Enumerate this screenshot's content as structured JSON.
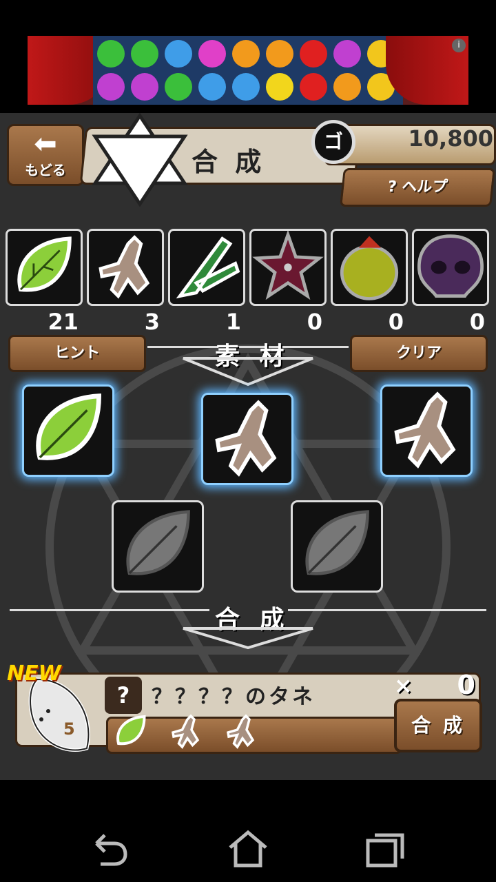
{
  "ad": {
    "info_icon": "info-icon",
    "candy_colors": [
      "#3bbf3b",
      "#3bbf3b",
      "#3f9de8",
      "#e040c8",
      "#f29a1c",
      "#f29a1c",
      "#e02020",
      "#c040d0",
      "#f2c61c",
      "#c040d0",
      "#c040d0",
      "#3bbf3b",
      "#3f9de8",
      "#3f9de8",
      "#f2d61c",
      "#e02020",
      "#f29a1c",
      "#f2c61c"
    ]
  },
  "header": {
    "back_label": "もどる",
    "back_icon": "arrow-left-icon",
    "title": "合 成",
    "coin_glyph": "ゴ",
    "money": "10,800",
    "help_label": "? ヘルプ"
  },
  "inventory": [
    {
      "item": "leaf",
      "count": "21"
    },
    {
      "item": "root",
      "count": "3"
    },
    {
      "item": "leek",
      "count": "1"
    },
    {
      "item": "flower",
      "count": "0"
    },
    {
      "item": "fruit",
      "count": "0"
    },
    {
      "item": "skull",
      "count": "0"
    }
  ],
  "materials": {
    "hint_label": "ヒント",
    "section_label": "素 材",
    "clear_label": "クリア"
  },
  "synthesis": {
    "section_label": "合 成"
  },
  "result": {
    "new_label": "NEW",
    "level": "5",
    "unknown_mark": "?",
    "name": "？？？？のタネ",
    "x_mark": "×",
    "quantity": "0",
    "synth_button_label": "合 成"
  },
  "colors": {
    "leaf_green": "#8ccf3a",
    "root_tan": "#a89080",
    "slot_glow": "#5fb6ff",
    "button_brown": "#8a5a32"
  }
}
